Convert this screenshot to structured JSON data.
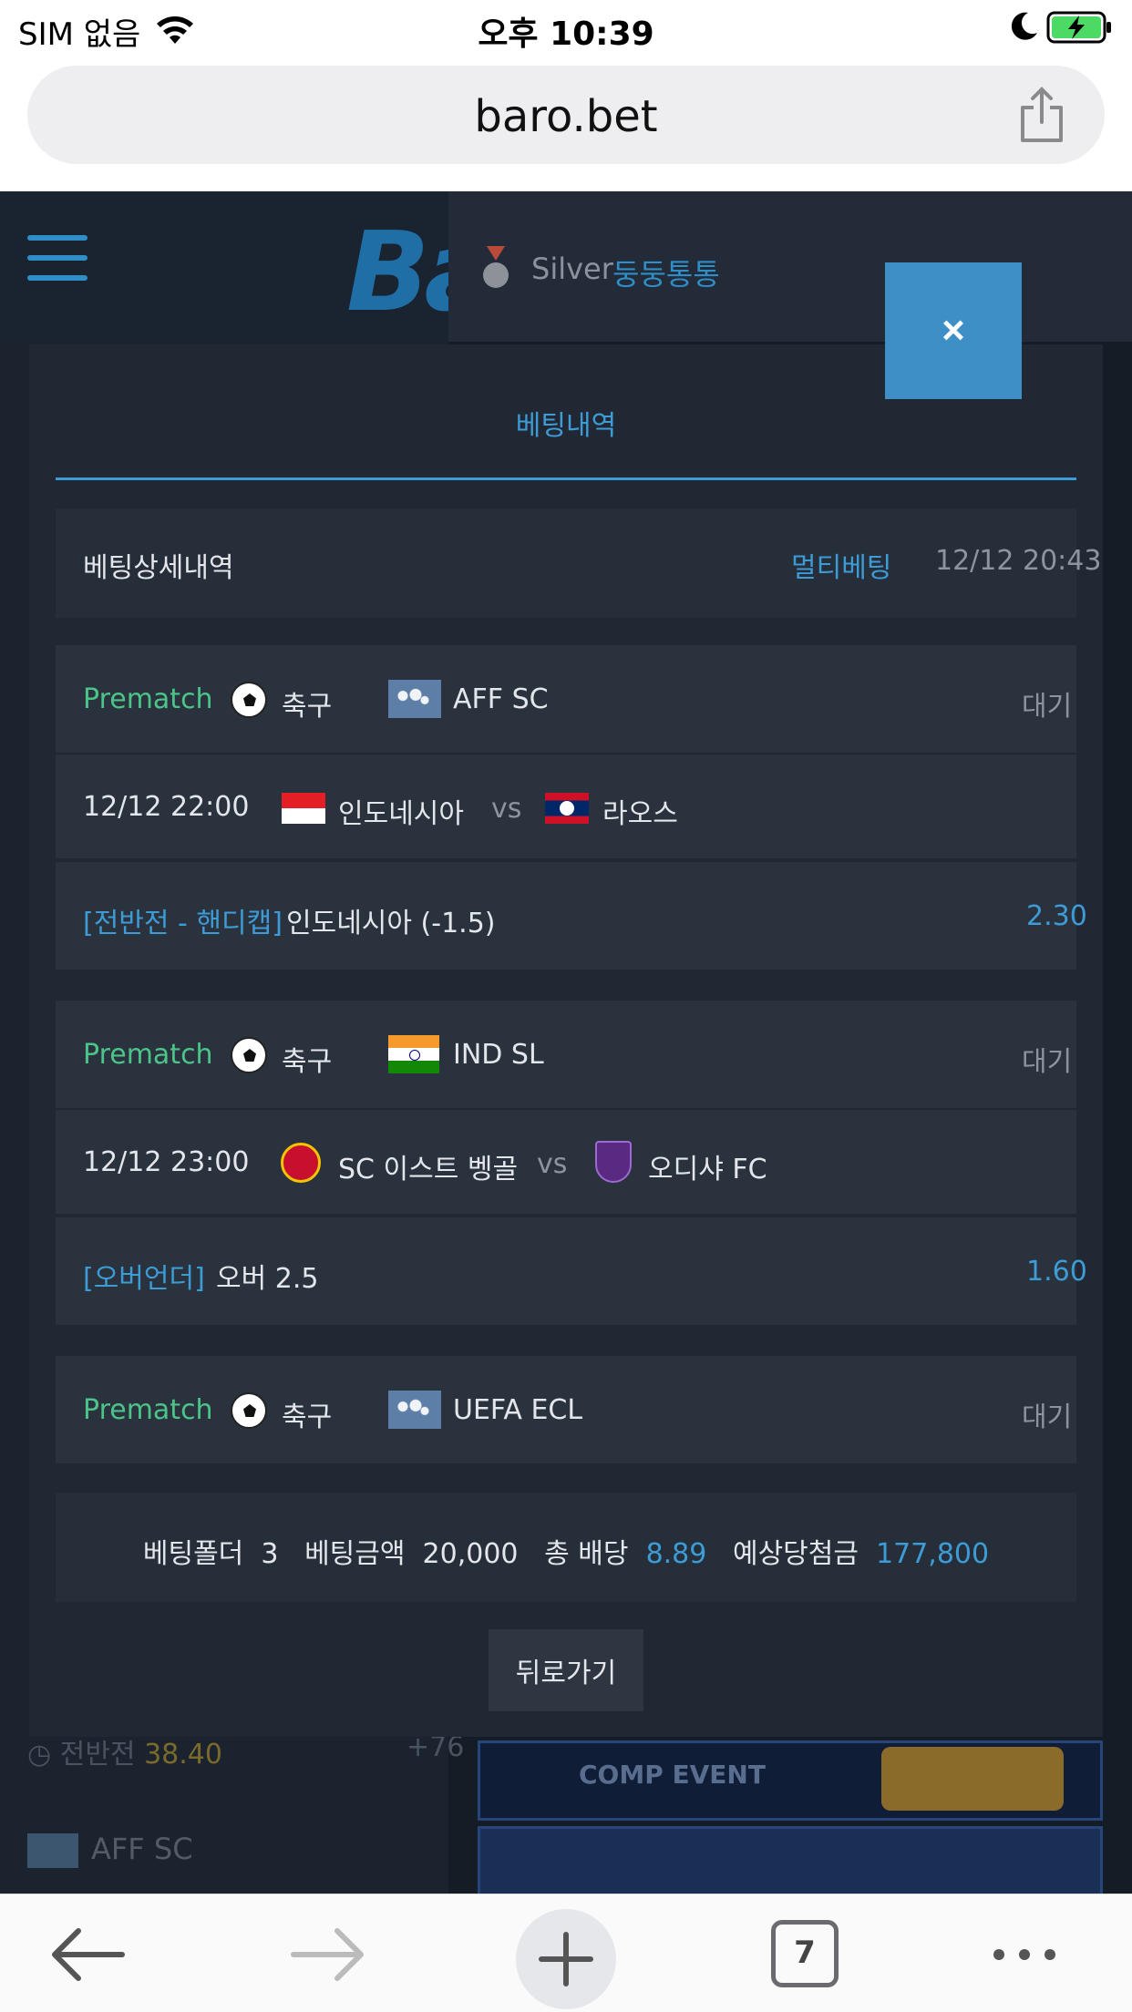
{
  "status_bar": {
    "carrier": "SIM 없음",
    "time": "오후 10:39"
  },
  "browser": {
    "url": "baro.bet",
    "tab_count": "7"
  },
  "background_page": {
    "logo": "Ba",
    "user": {
      "tier": "Silver",
      "nickname": "둥둥통통"
    },
    "list_row": {
      "label": "전반전",
      "odds": "38.40",
      "plus": "+76"
    },
    "league_row": "AFF SC",
    "banner_text": "COMP EVENT"
  },
  "modal": {
    "close_label": "×",
    "tab_label": "베팅내역",
    "header": {
      "title": "베팅상세내역",
      "type": "멀티베팅",
      "datetime": "12/12 20:43"
    },
    "bets": [
      {
        "category": "Prematch",
        "sport": "축구",
        "league": "AFF SC",
        "status": "대기",
        "datetime": "12/12 22:00",
        "home": "인도네시아",
        "vs": "vs",
        "away": "라오스",
        "market": "[전반전 - 핸디캡]",
        "pick": "인도네시아 (-1.5)",
        "odds": "2.30"
      },
      {
        "category": "Prematch",
        "sport": "축구",
        "league": "IND SL",
        "status": "대기",
        "datetime": "12/12 23:00",
        "home": "SC 이스트 벵골",
        "vs": "vs",
        "away": "오디샤 FC",
        "market": "[오버언더]",
        "pick": "오버 2.5",
        "odds": "1.60"
      },
      {
        "category": "Prematch",
        "sport": "축구",
        "league": "UEFA ECL",
        "status": "대기"
      }
    ],
    "summary": {
      "folder_label": "베팅폴더",
      "folder_value": "3",
      "amount_label": "베팅금액",
      "amount_value": "20,000",
      "odds_label": "총 배당",
      "odds_value": "8.89",
      "payout_label": "예상당첨금",
      "payout_value": "177,800"
    },
    "back_label": "뒤로가기"
  },
  "colors": {
    "accent": "#3d9bd6",
    "prematch": "#4cc489",
    "panel": "#212834",
    "close_bg": "#3d8fc6"
  }
}
